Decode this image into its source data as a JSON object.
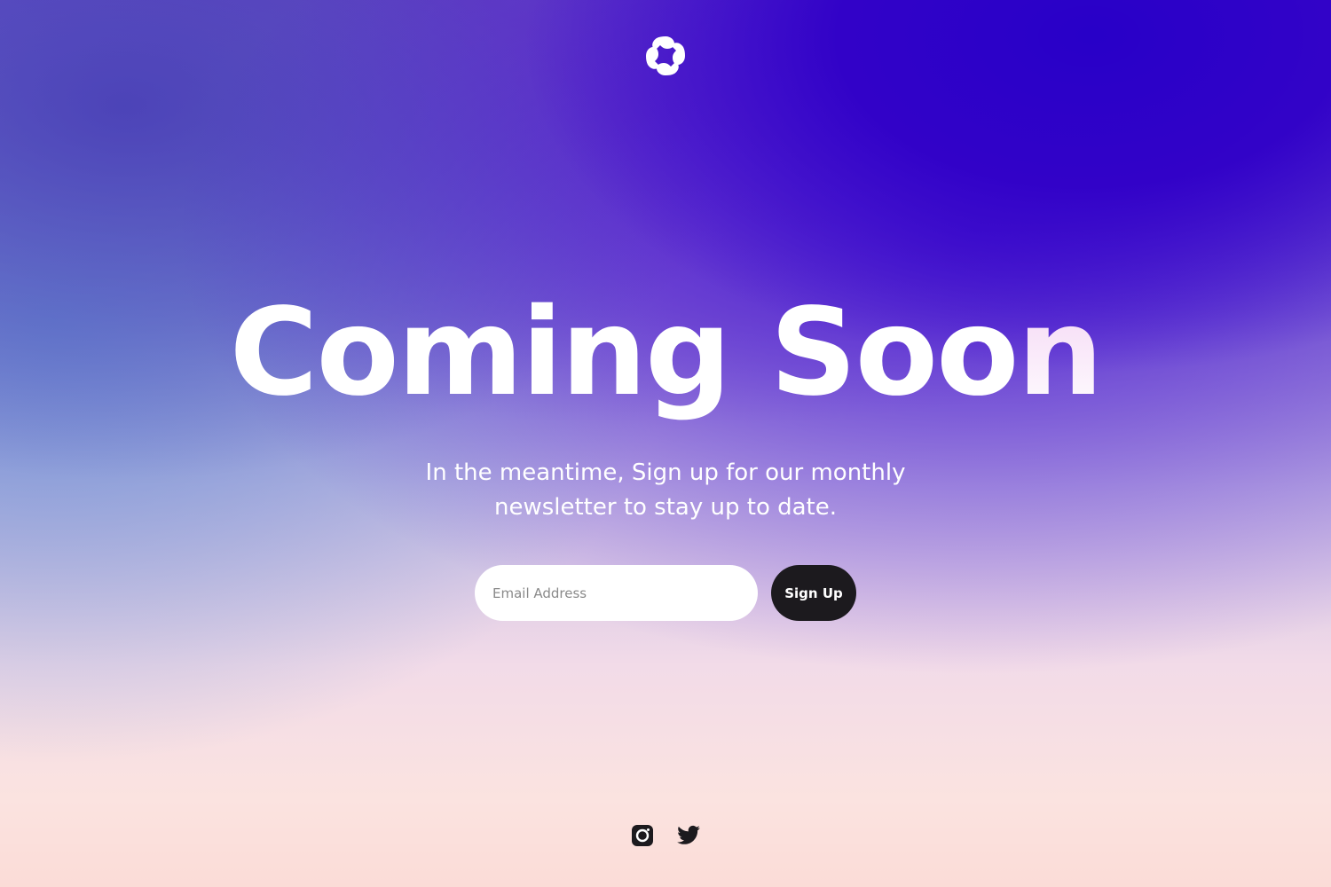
{
  "hero": {
    "title_main": "Coming Soo",
    "title_accent": "n",
    "subtitle": "In the meantime, Sign up for our monthly newsletter to stay up to date."
  },
  "signup": {
    "email_placeholder": "Email Address",
    "email_value": "",
    "button_label": "Sign Up"
  },
  "social": {
    "icons": [
      "instagram-icon",
      "twitter-icon"
    ]
  },
  "colors": {
    "background_top_right": "#2800c8",
    "background_bottom": "#fbdcd7",
    "button_background": "#1c1a1e",
    "text": "#ffffff"
  }
}
